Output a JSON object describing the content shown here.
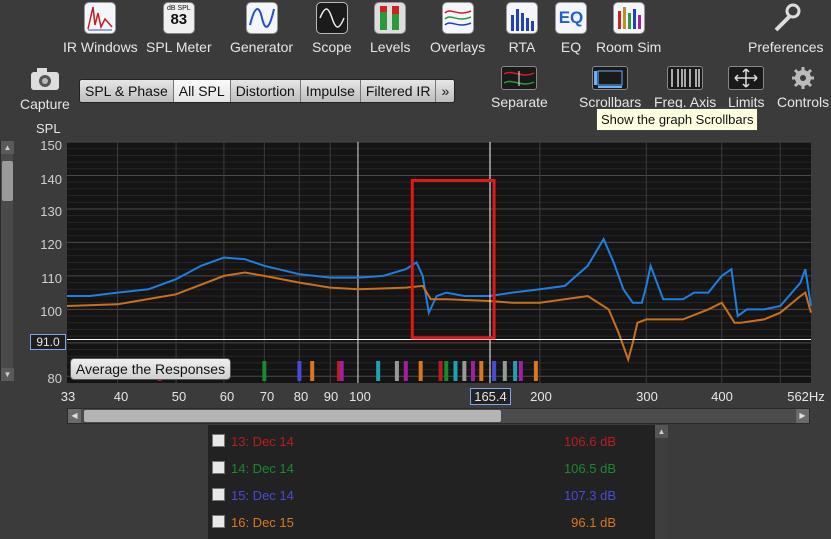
{
  "toolbar": {
    "items": [
      {
        "label": "IR Windows",
        "icon": "ir-windows-icon"
      },
      {
        "label": "SPL Meter",
        "icon": "spl-meter-icon",
        "meter_unit": "dB SPL",
        "meter_value": "83"
      },
      {
        "label": "Generator",
        "icon": "generator-icon"
      },
      {
        "label": "Scope",
        "icon": "scope-icon"
      },
      {
        "label": "Levels",
        "icon": "levels-icon"
      },
      {
        "label": "Overlays",
        "icon": "overlays-icon"
      },
      {
        "label": "RTA",
        "icon": "rta-icon"
      },
      {
        "label": "EQ",
        "icon": "eq-icon"
      },
      {
        "label": "Room Sim",
        "icon": "room-sim-icon"
      },
      {
        "label": "Preferences",
        "icon": "wrench-icon"
      }
    ]
  },
  "capture": {
    "label": "Capture",
    "icon": "camera-icon"
  },
  "tabs": [
    {
      "label": "SPL & Phase",
      "active": false
    },
    {
      "label": "All SPL",
      "active": true
    },
    {
      "label": "Distortion",
      "active": false
    },
    {
      "label": "Impulse",
      "active": false
    },
    {
      "label": "Filtered IR",
      "active": false
    },
    {
      "label": "»",
      "active": false
    }
  ],
  "graph_tools": [
    {
      "label": "Separate",
      "icon": "separate-icon"
    },
    {
      "label": "Scrollbars",
      "icon": "scrollbars-icon"
    },
    {
      "label": "Freq. Axis",
      "icon": "freq-axis-icon"
    },
    {
      "label": "Limits",
      "icon": "limits-icon"
    },
    {
      "label": "Controls",
      "icon": "gear-icon"
    }
  ],
  "tooltip": "Show the graph Scrollbars",
  "graph": {
    "y_axis_label": "SPL",
    "y_ticks": [
      "150",
      "140",
      "130",
      "120",
      "110",
      "100",
      "80"
    ],
    "x_ticks": [
      "33",
      "40",
      "50",
      "60",
      "70",
      "80",
      "90",
      "100",
      "200",
      "300",
      "400",
      "562Hz"
    ],
    "cursor_y": "91.0",
    "cursor_x": "165.4",
    "average_button": "Average the Responses"
  },
  "chart_data": {
    "type": "line",
    "title": "",
    "xlabel": "",
    "ylabel": "SPL",
    "x_scale": "log",
    "xlim": [
      33,
      562
    ],
    "ylim": [
      78,
      150
    ],
    "grid": true,
    "series": [
      {
        "color": "#1f7fe0",
        "x": [
          33,
          36,
          40,
          45,
          50,
          55,
          60,
          65,
          70,
          80,
          90,
          100,
          110,
          120,
          125,
          128,
          131,
          135,
          140,
          150,
          165,
          180,
          200,
          220,
          240,
          255,
          265,
          275,
          285,
          295,
          300,
          305,
          320,
          345,
          360,
          380,
          400,
          415,
          425,
          440,
          470,
          500,
          540,
          550,
          562
        ],
        "y": [
          104,
          104,
          105,
          106,
          109,
          113,
          115.5,
          115,
          113,
          110.5,
          109.5,
          109.5,
          110,
          112,
          114,
          110,
          99,
          104,
          105,
          104,
          104,
          105,
          106,
          107,
          113,
          121,
          114,
          106,
          102,
          102,
          107,
          113,
          103,
          103,
          105,
          105,
          110,
          112,
          98,
          100,
          100,
          101,
          108,
          112,
          101
        ]
      },
      {
        "color": "#c8701e",
        "x": [
          33,
          40,
          50,
          60,
          65,
          70,
          80,
          90,
          100,
          120,
          128,
          132,
          140,
          165,
          180,
          200,
          240,
          260,
          270,
          280,
          285,
          290,
          300,
          320,
          345,
          380,
          400,
          420,
          430,
          470,
          500,
          540,
          550,
          562
        ],
        "y": [
          101,
          101.5,
          104.5,
          110,
          111,
          110,
          108,
          106.5,
          106,
          106.5,
          107,
          103,
          103,
          102.5,
          102,
          102,
          104,
          100,
          93,
          85,
          90,
          96,
          97,
          97,
          97,
          100,
          102,
          96,
          96,
          97,
          99,
          104,
          105,
          99
        ]
      }
    ]
  },
  "list": [
    {
      "name": "13: Dec 14",
      "value": "106.6 dB",
      "color": "#b81e1e"
    },
    {
      "name": "14: Dec 14",
      "value": "106.5 dB",
      "color": "#178a2e"
    },
    {
      "name": "15: Dec 14",
      "value": "107.3 dB",
      "color": "#4a4ad8"
    },
    {
      "name": "16: Dec 15",
      "value": "96.1 dB",
      "color": "#d9781e"
    }
  ]
}
